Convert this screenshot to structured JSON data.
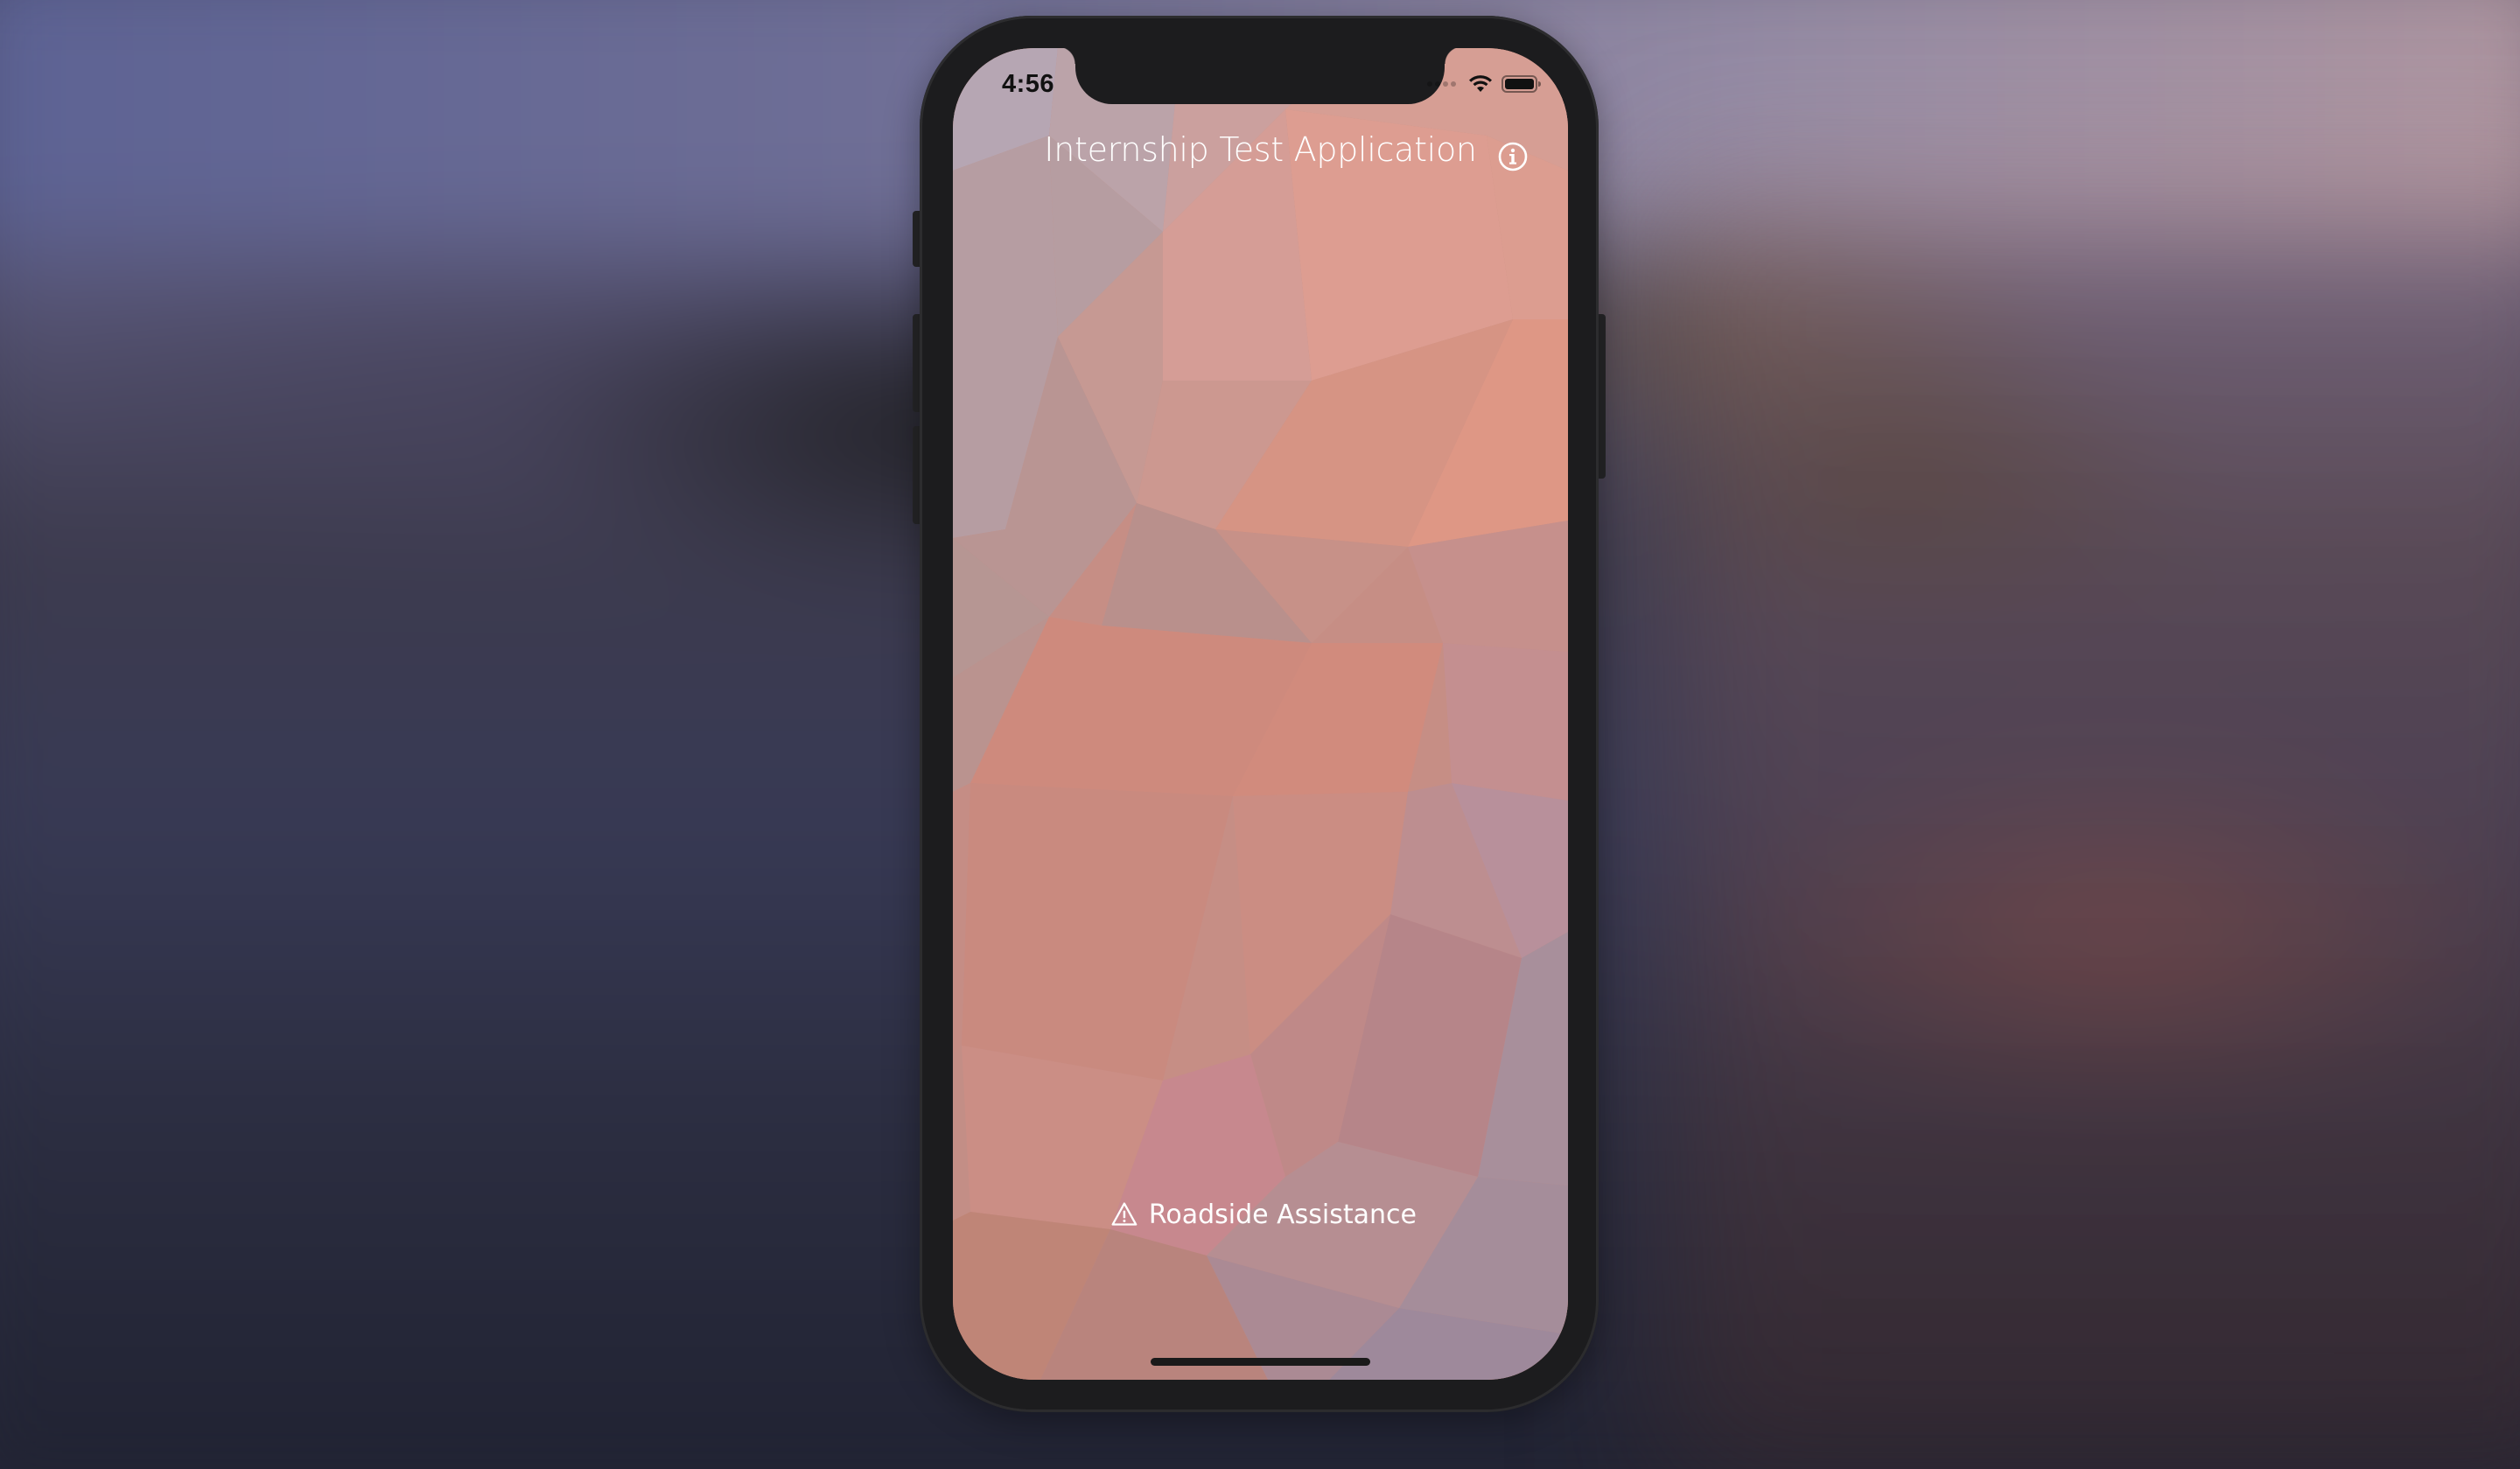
{
  "status_bar": {
    "time": "4:56",
    "wifi_icon": "wifi-icon",
    "battery_icon": "battery-full-icon"
  },
  "nav_bar": {
    "title": "Internship Test Application",
    "info_icon": "info-circle-icon"
  },
  "main": {
    "roadside_button_label": "Roadside Assistance",
    "roadside_icon": "warning-triangle-icon"
  },
  "colors": {
    "text_on_background": "#ffffff",
    "background_accent": "#d88c7c",
    "device_frame": "#1c1c1e"
  }
}
